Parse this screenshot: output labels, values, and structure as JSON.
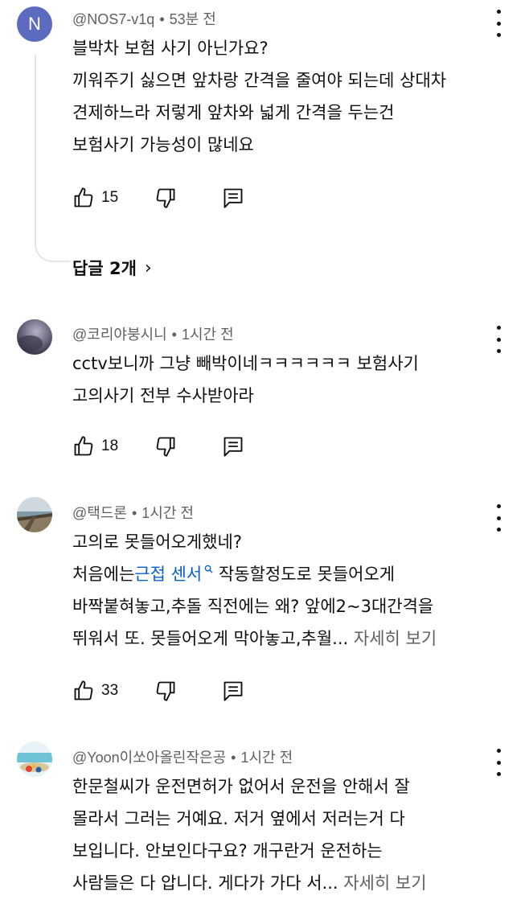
{
  "comments": [
    {
      "author": "@NOS7-v1q",
      "time": "53분 전",
      "avatar_letter": "N",
      "lines": [
        "블박차 보험 사기 아닌가요?",
        "끼워주기 싫으면 앞차랑 간격을 줄여야 되는데 상대차",
        "견제하느라 저렇게 앞차와 넓게 간격을 두는건",
        "보험사기 가능성이 많네요"
      ],
      "likes": "15",
      "replies_label": "답글 2개",
      "replies_chevron": "›"
    },
    {
      "author": "@코리야붕시니",
      "time": "1시간 전",
      "lines": [
        "cctv보니까 그냥 빼박이네ㅋㅋㅋㅋㅋㅋ 보험사기",
        "고의사기 전부 수사받아라"
      ],
      "likes": "18"
    },
    {
      "author": "@택드론",
      "time": "1시간 전",
      "line1": "고의로 못들어오게했네?",
      "line2_prefix": "처음에는",
      "line2_link": "근접 센서",
      "line2_suffix": " 작동할정도로 못들어오게",
      "line3": "바짝붙혀놓고,추돌 직전에는 왜? 앞에2~3대간격을",
      "line4": "뛰워서 또. 못들어오게 막아놓고,추월...",
      "more": " 자세히 보기",
      "likes": "33"
    },
    {
      "author": "@Yoon이쏘아올린작은공",
      "time": "1시간 전",
      "line1": "한문철씨가 운전면허가 없어서 운전을 안해서 잘",
      "line2": "몰라서 그러는 거예요. 저거 옆에서 저러는거 다",
      "line3": "보입니다. 안보인다구요? 개구란거 운전하는",
      "line4": "사람들은 다 압니다. 게다가 가다 서...",
      "more": " 자세히 보기"
    }
  ],
  "separator": "•",
  "icons": {
    "like": "thumb-up-icon",
    "dislike": "thumb-down-icon",
    "reply": "reply-icon",
    "menu": "kebab-menu-icon",
    "search": "search-icon"
  },
  "colors": {
    "link": "#065fd4",
    "meta": "#606060",
    "avatar_n": "#5c6bc0"
  }
}
